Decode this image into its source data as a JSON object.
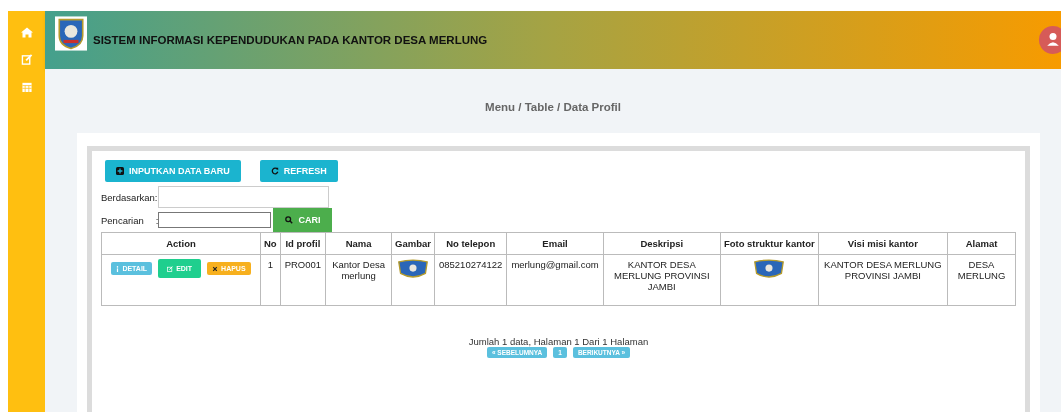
{
  "header": {
    "title": "SISTEM INFORMASI KEPENDUDUKAN PADA KANTOR DESA MERLUNG"
  },
  "breadcrumb": "Menu / Table / Data Profil",
  "toolbar": [
    "INPUTKAN DATA BARU",
    "REFRESH"
  ],
  "filter": {
    "by_label": "Berdasarkan:",
    "search_label": "Pencarian",
    "search_separator": ":",
    "search_button": "CARI"
  },
  "table": {
    "columns": [
      "Action",
      "No",
      "Id profil",
      "Nama",
      "Gambar",
      "No telepon",
      "Email",
      "Deskripsi",
      "Foto struktur kantor",
      "Visi misi kantor",
      "Alamat"
    ],
    "rows": [
      {
        "cells": [
          {
            "kind": "actions",
            "buttons": [
              "DETAIL",
              "EDIT",
              "HAPUS"
            ]
          },
          {
            "kind": "text",
            "text": "1"
          },
          {
            "kind": "text",
            "text": "PRO001"
          },
          {
            "kind": "text",
            "text": "Kantor Desa merlung"
          },
          {
            "kind": "image"
          },
          {
            "kind": "text",
            "text": "085210274122"
          },
          {
            "kind": "text",
            "text": "merlung@gmail.com"
          },
          {
            "kind": "text",
            "text": "KANTOR DESA MERLUNG PROVINSI JAMBI"
          },
          {
            "kind": "image"
          },
          {
            "kind": "text",
            "text": "KANTOR DESA MERLUNG PROVINSI JAMBI"
          },
          {
            "kind": "text",
            "text": "DESA MERLUNG"
          }
        ]
      }
    ]
  },
  "summary": "Jumlah 1 data, Halaman 1 Dari 1 Halaman",
  "pagination": [
    "« SEBELUMNYA",
    "1",
    "BERIKUTNYA »"
  ]
}
